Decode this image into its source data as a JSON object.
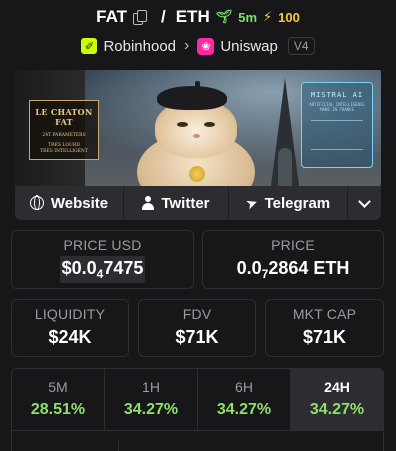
{
  "header": {
    "base_symbol": "FAT",
    "quote_symbol": "ETH",
    "separator": "/",
    "age": "5m",
    "boosts": "100",
    "chain_name": "Robinhood",
    "dex_name": "Uniswap",
    "dex_version": "V4"
  },
  "banner": {
    "left_sign_title": "LE CHATON FAT",
    "left_sign_line1": "24T PARAMETERS",
    "left_sign_line2": "TRÈS LOURD",
    "left_sign_line3": "TRÈS INTELLIGENT",
    "right_sign_title": "MISTRAL AI",
    "right_sign_sub": "ARTIFICIAL INTELLIGENCE MADE IN FRANCE"
  },
  "links": {
    "website": "Website",
    "twitter": "Twitter",
    "telegram": "Telegram"
  },
  "stats": {
    "price_usd_label": "PRICE USD",
    "price_usd_prefix": "$0.0",
    "price_usd_zeros": "4",
    "price_usd_digits": "7475",
    "price_label": "PRICE",
    "price_eth_prefix": "0.0",
    "price_eth_zeros": "7",
    "price_eth_digits": "2864 ETH",
    "liquidity_label": "LIQUIDITY",
    "liquidity_value": "$24K",
    "fdv_label": "FDV",
    "fdv_value": "$71K",
    "mktcap_label": "MKT CAP",
    "mktcap_value": "$71K"
  },
  "timeframes": [
    {
      "label": "5M",
      "change": "28.51%"
    },
    {
      "label": "1H",
      "change": "34.27%"
    },
    {
      "label": "6H",
      "change": "34.27%"
    },
    {
      "label": "24H",
      "change": "34.27%"
    }
  ],
  "active_timeframe": "24H",
  "colors": {
    "positive": "#8ee06a",
    "age": "#7ddf6c",
    "boost": "#f7c948",
    "chain_brand": "#ccff00",
    "dex_brand": "#ff2aa3"
  }
}
